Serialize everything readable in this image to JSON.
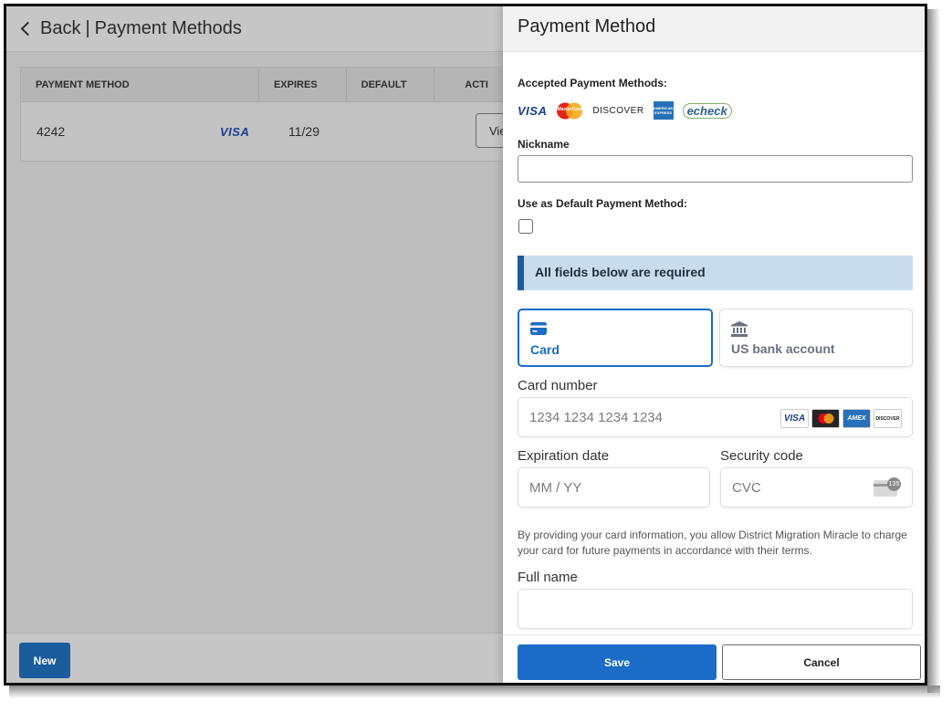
{
  "background_page": {
    "back_label": "Back",
    "title": "Payment Methods",
    "table": {
      "columns": [
        "PAYMENT METHOD",
        "EXPIRES",
        "DEFAULT",
        "ACTI"
      ],
      "rows": [
        {
          "number": "4242",
          "brand": "VISA",
          "expires": "11/29",
          "default": "",
          "action": "Vie"
        }
      ]
    },
    "new_button": "New"
  },
  "panel": {
    "title": "Payment Method",
    "accepted_label": "Accepted Payment Methods:",
    "accepted_logos": [
      "VISA",
      "MasterCard",
      "DISCOVER",
      "AMERICAN EXPRESS",
      "echeck"
    ],
    "nickname_label": "Nickname",
    "nickname_value": "",
    "default_label": "Use as Default Payment Method:",
    "default_checked": false,
    "required_notice": "All fields below are required",
    "tabs": [
      {
        "label": "Card",
        "icon": "card-icon",
        "selected": true
      },
      {
        "label": "US bank account",
        "icon": "bank-icon",
        "selected": false
      }
    ],
    "card_number_label": "Card number",
    "card_number_placeholder": "1234 1234 1234 1234",
    "card_brands": [
      "VISA",
      "mastercard",
      "AMEX",
      "DISCOVER"
    ],
    "expiration_label": "Expiration date",
    "expiration_placeholder": "MM / YY",
    "security_label": "Security code",
    "security_placeholder": "CVC",
    "cvc_icon_text": "135",
    "disclaimer": "By providing your card information, you allow District Migration Miracle to charge your card for future payments in accordance with their terms.",
    "full_name_label": "Full name",
    "full_name_value": "",
    "save_button": "Save",
    "cancel_button": "Cancel"
  },
  "colors": {
    "primary": "#1a6cc7",
    "primary_dark": "#1a5c9c",
    "notice_bg": "#c9dcee",
    "overlay": "#bdbdbd"
  }
}
